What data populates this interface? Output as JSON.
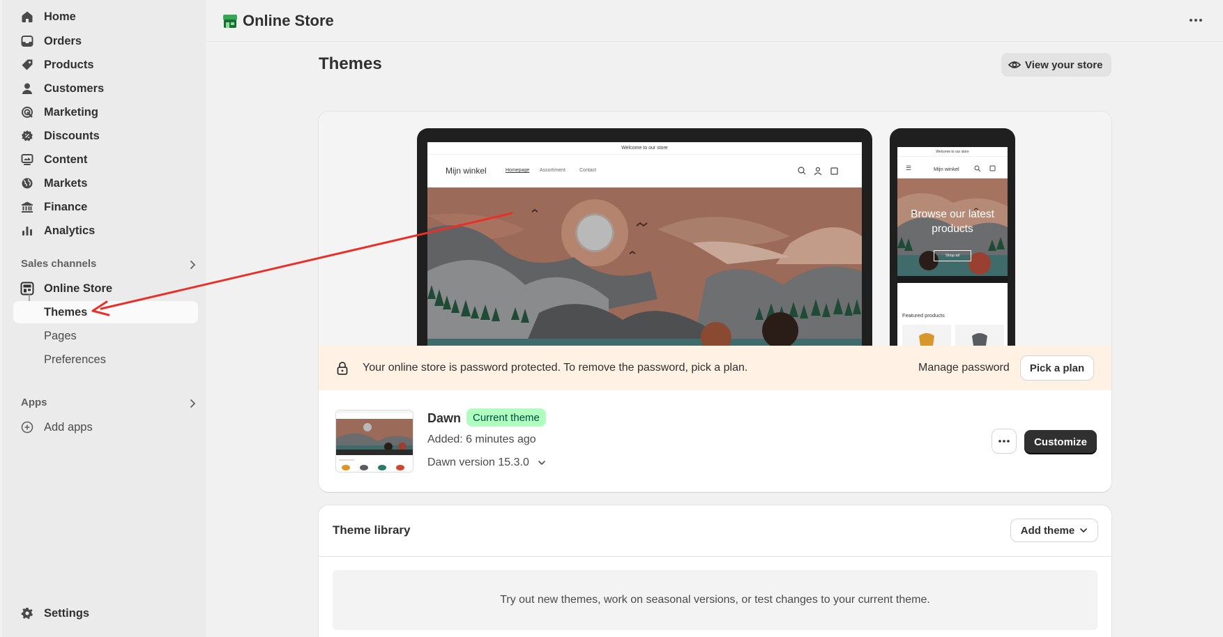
{
  "sidebar": {
    "items": [
      {
        "label": "Home",
        "icon": "home-icon"
      },
      {
        "label": "Orders",
        "icon": "inbox-icon"
      },
      {
        "label": "Products",
        "icon": "tag-icon"
      },
      {
        "label": "Customers",
        "icon": "person-icon"
      },
      {
        "label": "Marketing",
        "icon": "target-icon"
      },
      {
        "label": "Discounts",
        "icon": "discount-icon"
      },
      {
        "label": "Content",
        "icon": "content-icon"
      },
      {
        "label": "Markets",
        "icon": "globe-icon"
      },
      {
        "label": "Finance",
        "icon": "bank-icon"
      },
      {
        "label": "Analytics",
        "icon": "bar-chart-icon"
      }
    ],
    "sales_channels_label": "Sales channels",
    "online_store_label": "Online Store",
    "sub_items": [
      {
        "label": "Themes"
      },
      {
        "label": "Pages"
      },
      {
        "label": "Preferences"
      }
    ],
    "apps_label": "Apps",
    "add_apps_label": "Add apps",
    "settings_label": "Settings"
  },
  "topbar": {
    "title": "Online Store"
  },
  "page": {
    "title": "Themes",
    "view_store_label": "View your store"
  },
  "preview": {
    "laptop": {
      "announcement": "Welcome to our store",
      "store_name": "Mijn winkel",
      "nav": [
        "Homepage",
        "Assortiment",
        "Contact"
      ]
    },
    "phone": {
      "announcement": "Welcome to our store",
      "store_name": "Mijn winkel",
      "hero_text": "Browse our latest products",
      "hero_button": "Shop all",
      "featured_label": "Featured products"
    }
  },
  "banner": {
    "message": "Your online store is password protected. To remove the password, pick a plan.",
    "manage_label": "Manage password",
    "pick_plan_label": "Pick a plan",
    "background": "#fff1e3"
  },
  "current_theme": {
    "name": "Dawn",
    "badge": "Current theme",
    "added": "Added: 6 minutes ago",
    "version": "Dawn version 15.3.0",
    "customize_label": "Customize",
    "badge_color": "#affebf"
  },
  "library": {
    "title": "Theme library",
    "add_theme_label": "Add theme",
    "empty_text": "Try out new themes, work on seasonal versions, or test changes to your current theme."
  },
  "annotation": {
    "color": "#e8302a"
  }
}
